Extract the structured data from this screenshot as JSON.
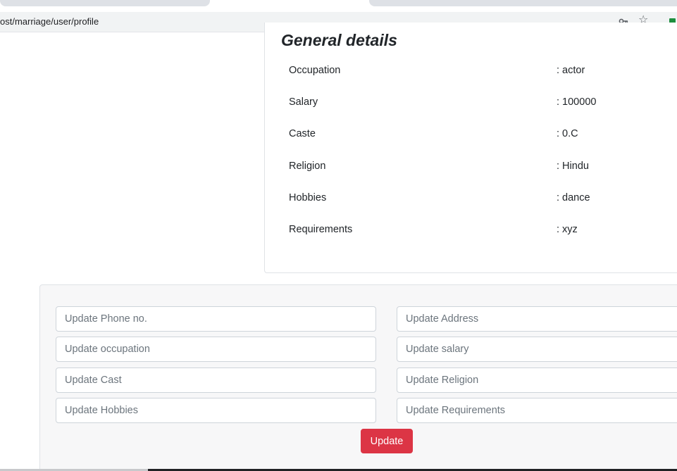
{
  "browser": {
    "url": "ost/marriage/user/profile",
    "icons": {
      "key": "key-icon",
      "bookmark": "star-icon",
      "extension": "extension-icon"
    }
  },
  "details": {
    "title": "General details",
    "rows": [
      {
        "label": "Occupation",
        "value": ": actor"
      },
      {
        "label": "Salary",
        "value": ": 100000"
      },
      {
        "label": "Caste",
        "value": ": 0.C"
      },
      {
        "label": "Religion",
        "value": ": Hindu"
      },
      {
        "label": "Hobbies",
        "value": ": dance"
      },
      {
        "label": "Requirements",
        "value": ": xyz"
      }
    ]
  },
  "form": {
    "phone": {
      "placeholder": "Update Phone no.",
      "value": ""
    },
    "address": {
      "placeholder": "Update Address",
      "value": ""
    },
    "occupation": {
      "placeholder": "Update occupation",
      "value": ""
    },
    "salary": {
      "placeholder": "Update salary",
      "value": ""
    },
    "cast": {
      "placeholder": "Update Cast",
      "value": ""
    },
    "religion": {
      "placeholder": "Update Religion",
      "value": ""
    },
    "hobbies": {
      "placeholder": "Update Hobbies",
      "value": ""
    },
    "requirements": {
      "placeholder": "Update Requirements",
      "value": ""
    },
    "submit_label": "Update"
  },
  "colors": {
    "primary_button": "#dc3545",
    "text": "#212529",
    "placeholder": "#6c757d",
    "panel_bg": "#f7f7f8"
  }
}
